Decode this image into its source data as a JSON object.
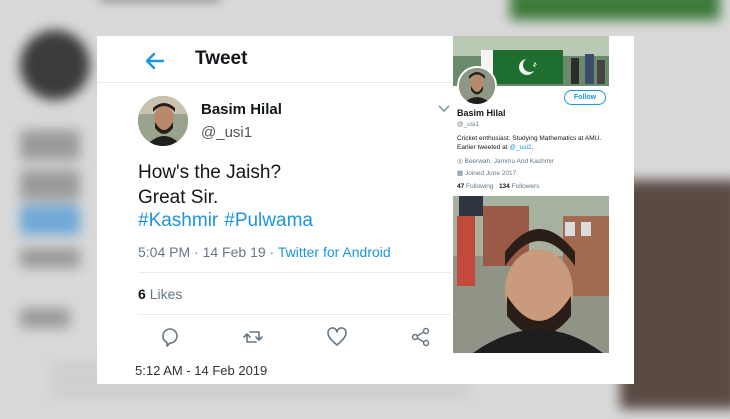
{
  "tweet": {
    "header_title": "Tweet",
    "author_name": "Basim Hilal",
    "author_handle": "@_usi1",
    "line1": "How's the Jaish?",
    "line2": "Great Sir.",
    "hashtags": [
      "#Kashmir",
      "#Pulwama"
    ],
    "time": "5:04 PM",
    "separator": "·",
    "date": "14 Feb 19",
    "source": "Twitter for Android",
    "likes_count": "6",
    "likes_label": "Likes",
    "bottom_timestamp": "5:12 AM - 14 Feb 2019",
    "accent_color": "#1b95e0"
  },
  "icons": {
    "back": "arrow-left-icon",
    "caret": "chevron-down-icon",
    "reply": "reply-icon",
    "retweet": "retweet-icon",
    "like": "heart-icon",
    "share": "share-icon",
    "location": "location-pin-icon",
    "calendar": "calendar-icon"
  },
  "profile": {
    "follow_label": "Follow",
    "name": "Basim Hilal",
    "handle": "@_usi1",
    "bio_text": "Cricket enthusiast. Studying Mathematics at AMU. Earlier tweeted at",
    "bio_link": "@_usi2",
    "bio_end": ".",
    "location": "Beerwah, Jammu And Kashmir",
    "joined": "Joined June 2017",
    "following_count": "47",
    "following_label": "Following",
    "followers_count": "134",
    "followers_label": "Followers"
  }
}
